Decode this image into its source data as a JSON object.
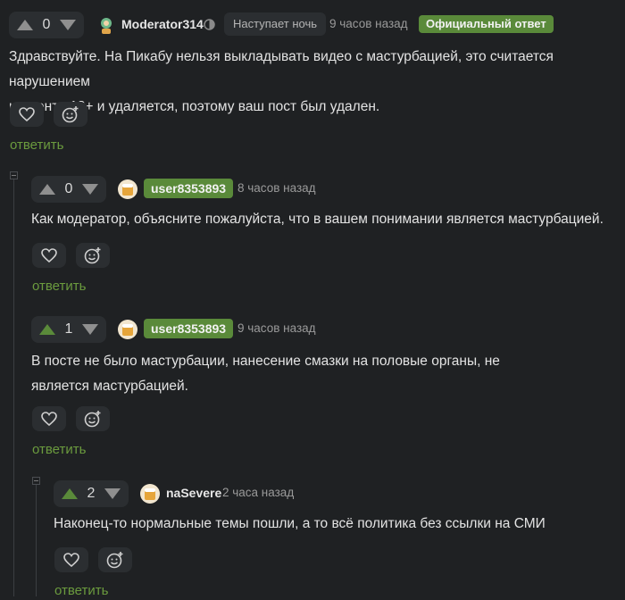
{
  "comments": [
    {
      "votes": "0",
      "username": "Moderator314",
      "status_tag": "Наступает ночь",
      "time": "9 часов назад",
      "official_badge": "Официальный ответ",
      "text_lines": [
        "Здравствуйте. На Пикабу нельзя выкладывать видео с мастурбацией, это считается нарушением",
        "контента 18+ и удаляется, поэтому ваш пост был удален."
      ],
      "reply_label": "ответить",
      "upvoted": false
    },
    {
      "votes": "0",
      "username": "user8353893",
      "time": "8 часов назад",
      "text_lines": [
        "Как модератор, объясните пожалуйста, что в вашем понимании является мастурбацией."
      ],
      "reply_label": "ответить",
      "upvoted": false
    },
    {
      "votes": "1",
      "username": "user8353893",
      "time": "9 часов назад",
      "text_lines": [
        "В посте не было мастурбации, нанесение смазки на половые органы, не",
        "является мастурбацией."
      ],
      "reply_label": "ответить",
      "upvoted": true
    },
    {
      "votes": "2",
      "username": "naSevere",
      "time": "2 часа назад",
      "text_lines": [
        "Наконец-то нормальные темы пошли, а то всё политика без ссылки на СМИ"
      ],
      "reply_label": "ответить",
      "upvoted": true
    }
  ],
  "icons": [
    "arrow-up-icon",
    "arrow-down-icon",
    "heart-icon",
    "add-emoji-icon",
    "collapse-icon",
    "moon-icon"
  ],
  "colors": {
    "accent_green": "#6b9b3e",
    "badge_green": "#5a8a3a",
    "background": "#1f2123",
    "panel": "#2b2e31"
  }
}
